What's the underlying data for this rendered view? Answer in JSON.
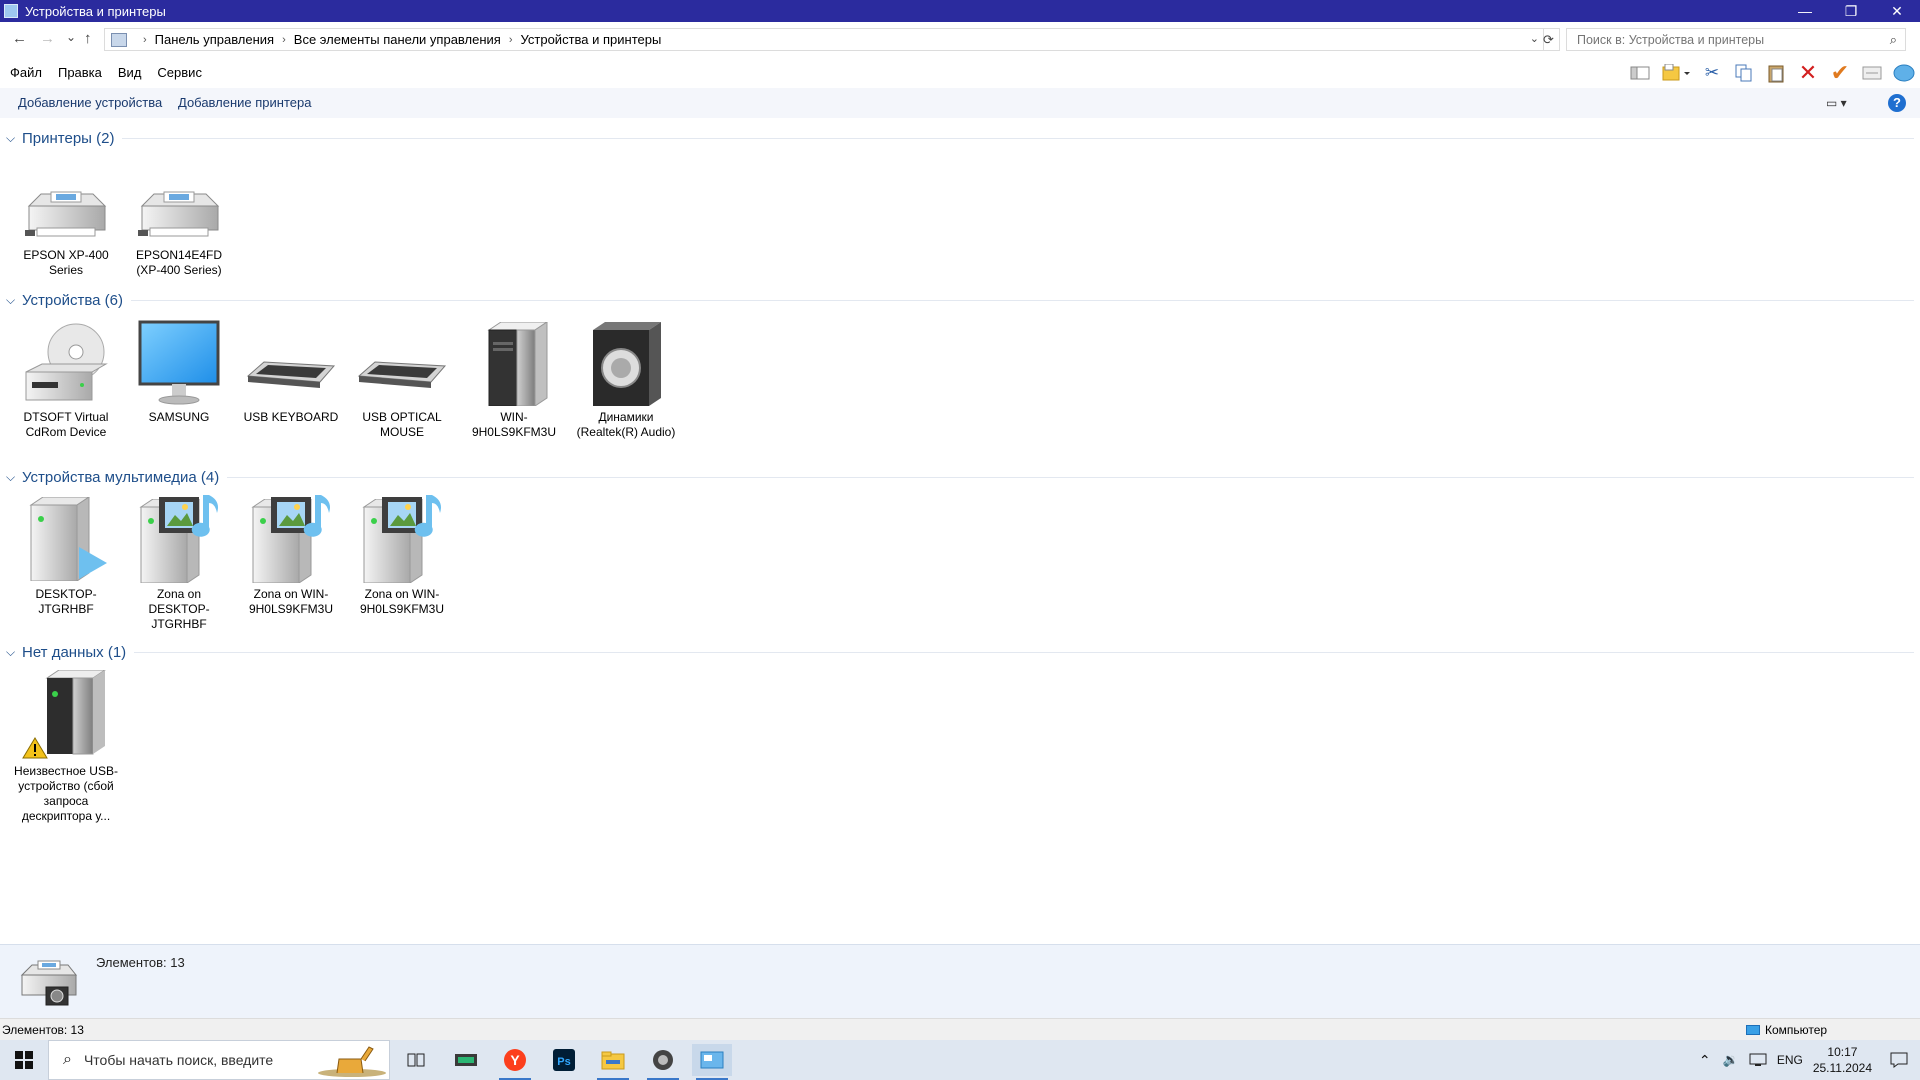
{
  "window": {
    "title": "Устройства и принтеры",
    "controls": [
      "—",
      "❐",
      "✕"
    ]
  },
  "address": {
    "nav": {
      "back": "←",
      "forward": "→",
      "recent": "⌄",
      "up": "↑"
    },
    "breadcrumb": [
      "Панель управления",
      "Все элементы панели управления",
      "Устройства и принтеры"
    ],
    "search_placeholder": "Поиск в: Устройства и принтеры"
  },
  "menu": [
    "Файл",
    "Правка",
    "Вид",
    "Сервис"
  ],
  "toolbar_icons": [
    "pane-icon",
    "new-folder-icon",
    "cut-icon",
    "copy-icon",
    "paste-icon",
    "delete-icon",
    "check-icon",
    "properties-icon",
    "globe-icon"
  ],
  "commands": {
    "add_device": "Добавление устройства",
    "add_printer": "Добавление принтера",
    "help": "?",
    "view": "▭ ▾"
  },
  "groups": [
    {
      "title": "Принтеры (2)",
      "items": [
        {
          "label": "EPSON XP-400 Series",
          "icon": "printer-icon"
        },
        {
          "label": "EPSON14E4FD (XP-400 Series)",
          "icon": "printer-icon"
        }
      ]
    },
    {
      "title": "Устройства (6)",
      "items": [
        {
          "label": "DTSOFT Virtual CdRom Device",
          "icon": "cdrom-icon"
        },
        {
          "label": "SAMSUNG",
          "icon": "monitor-icon"
        },
        {
          "label": "USB KEYBOARD",
          "icon": "keyboard-icon"
        },
        {
          "label": "USB OPTICAL MOUSE",
          "icon": "keyboard-icon"
        },
        {
          "label": "WIN-9H0LS9KFM3U",
          "icon": "computer-tower-icon"
        },
        {
          "label": "Динамики (Realtek(R) Audio)",
          "icon": "speaker-icon"
        }
      ]
    },
    {
      "title": "Устройства мультимедиа (4)",
      "items": [
        {
          "label": "DESKTOP-JTGRHBF",
          "icon": "media-server-icon"
        },
        {
          "label": "Zona on DESKTOP-JTGRHBF",
          "icon": "media-music-icon"
        },
        {
          "label": "Zona on WIN-9H0LS9KFM3U",
          "icon": "media-music-icon"
        },
        {
          "label": "Zona on WIN-9H0LS9KFM3U",
          "icon": "media-music-icon"
        }
      ]
    },
    {
      "title": "Нет данных (1)",
      "items": [
        {
          "label": "Неизвестное USB-устройство (сбой запроса дескриптора у...",
          "icon": "warning-device-icon"
        }
      ]
    }
  ],
  "details": {
    "count_text": "Элементов: 13",
    "icon": "camera-printer-icon"
  },
  "status": {
    "left": "Элементов: 13",
    "right": "Компьютер"
  },
  "taskbar": {
    "search_placeholder": "Чтобы начать поиск, введите",
    "apps": [
      "task-view-icon",
      "keyboard-app-icon",
      "yandex-browser-icon",
      "photoshop-icon",
      "file-explorer-icon",
      "app-icon",
      "devices-window-icon"
    ],
    "lang": "ENG",
    "time": "10:17",
    "date": "25.11.2024"
  },
  "colors": {
    "titlebar": "#2b2b9e",
    "group_title": "#1e4e8a",
    "accent": "#1f6fd0"
  }
}
